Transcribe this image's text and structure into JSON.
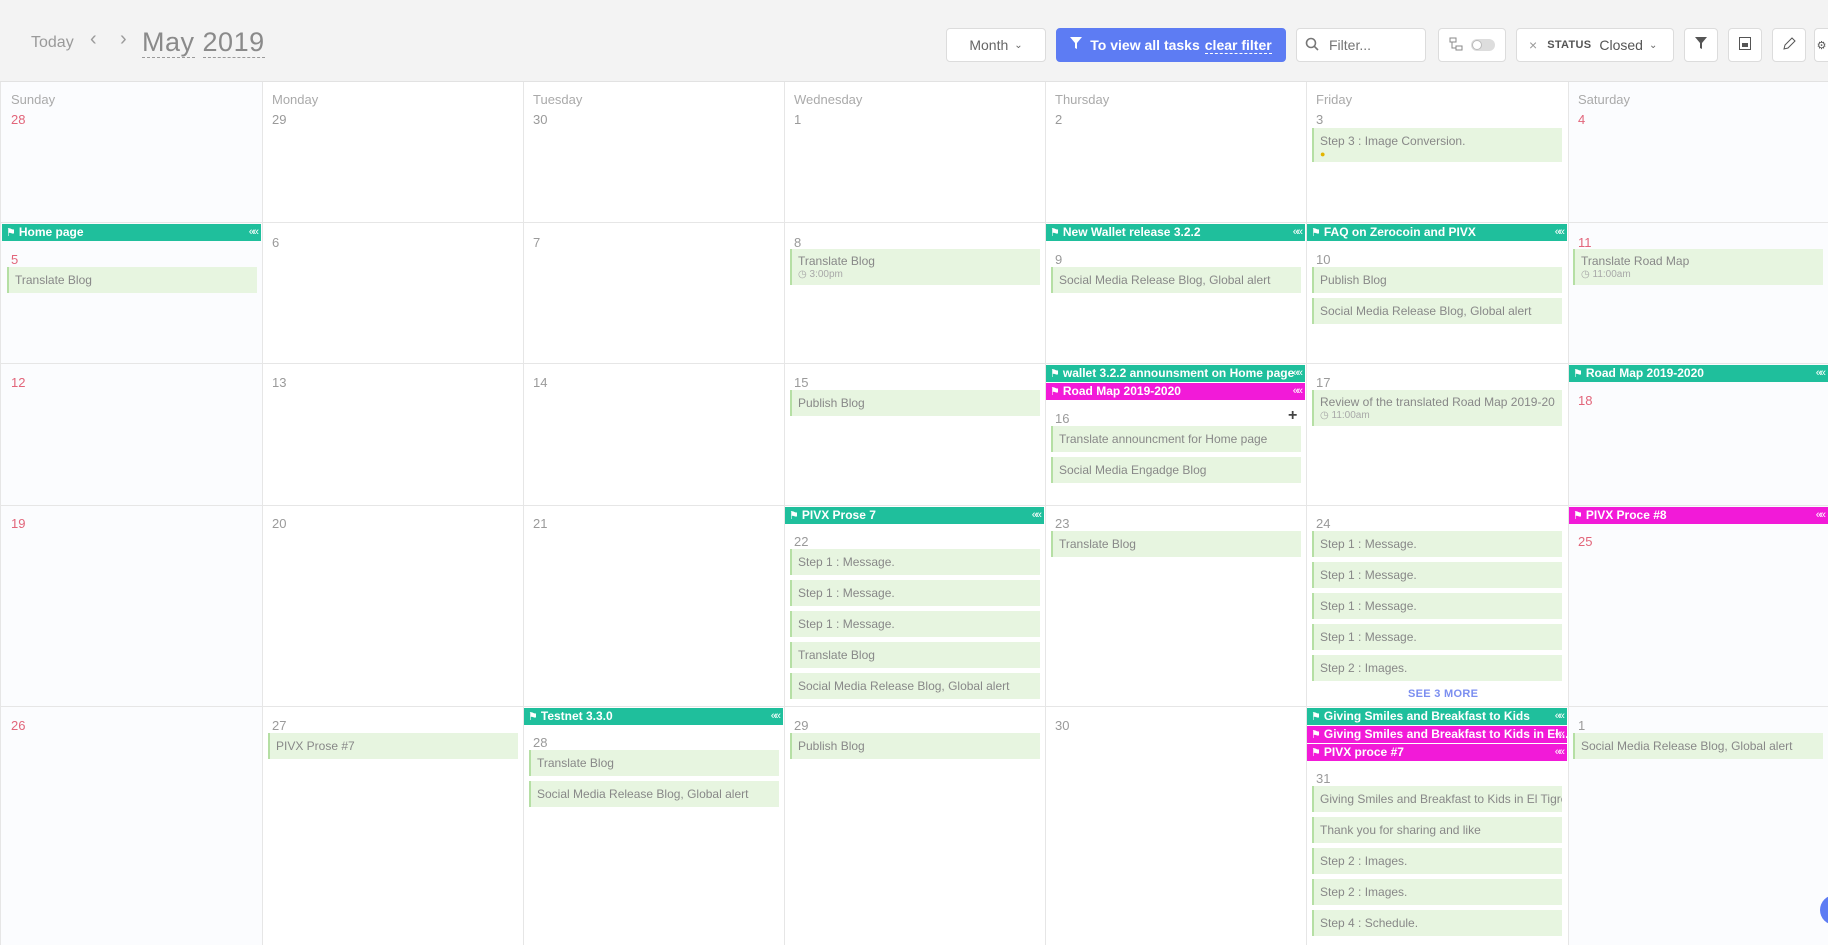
{
  "toolbar": {
    "today_label": "Today",
    "month_label": "May",
    "year_label": "2019",
    "view_select": "Month",
    "filter_banner_text": "To view all tasks",
    "filter_banner_link": "clear filter",
    "filter_placeholder": "Filter...",
    "status_label": "STATUS",
    "status_value": "Closed"
  },
  "weekdays": [
    "Sunday",
    "Monday",
    "Tuesday",
    "Wednesday",
    "Thursday",
    "Friday",
    "Saturday"
  ],
  "weeks": [
    [
      "28",
      "29",
      "30",
      "1",
      "2",
      "3",
      "4"
    ],
    [
      "5",
      "6",
      "7",
      "8",
      "9",
      "10",
      "11"
    ],
    [
      "12",
      "13",
      "14",
      "15",
      "16",
      "17",
      "18"
    ],
    [
      "19",
      "20",
      "21",
      "22",
      "23",
      "24",
      "25"
    ],
    [
      "26",
      "27",
      "28",
      "29",
      "30",
      "31",
      "1"
    ]
  ],
  "bars": {
    "home_page": "Home page",
    "new_wallet": "New Wallet release 3.2.2",
    "faq": "FAQ on Zerocoin and PIVX",
    "wallet_announce": "wallet 3.2.2 announsment on Home page",
    "roadmap_thu": "Road Map 2019-2020",
    "roadmap_sat": "Road Map 2019-2020",
    "pivx_prose7": "PIVX Prose 7",
    "pivx_proce8": "PIVX Proce #8",
    "testnet": "Testnet 3.3.0",
    "giving_smiles": "Giving Smiles and Breakfast to Kids",
    "giving_smiles_el": "Giving Smiles and Breakfast to Kids in El...",
    "pivx_proce7": "PIVX proce #7"
  },
  "tasks": {
    "step3_image": "Step 3 : Image Conversion.",
    "translate_blog_5": "Translate Blog",
    "translate_blog_8": "Translate Blog",
    "time_3pm": "3:00pm",
    "social_9": "Social Media Release Blog, Global alert",
    "publish_10": "Publish Blog",
    "social_10": "Social Media Release Blog, Global alert",
    "translate_roadmap": "Translate Road Map",
    "time_11am_a": "11:00am",
    "publish_15": "Publish Blog",
    "translate_announce": "Translate announcment for Home page",
    "social_engadge": "Social Media Engadge Blog",
    "review_roadmap": "Review of the translated Road Map 2019-20",
    "time_11am_b": "11:00am",
    "step1_a": "Step 1 : Message.",
    "step1_b": "Step 1 : Message.",
    "step1_c": "Step 1 : Message.",
    "translate_blog_22": "Translate Blog",
    "social_22": "Social Media Release Blog, Global alert",
    "translate_blog_23": "Translate Blog",
    "step1_d": "Step 1 : Message.",
    "step1_e": "Step 1 : Message.",
    "step1_f": "Step 1 : Message.",
    "step1_g": "Step 1 : Message.",
    "step2_a": "Step 2 : Images.",
    "see_more": "SEE 3 MORE",
    "pivx_prose_27": "PIVX Prose #7",
    "translate_blog_28": "Translate Blog",
    "social_28": "Social Media Release Blog, Global alert",
    "publish_29": "Publish Blog",
    "giving_31": "Giving Smiles and Breakfast to Kids in El Tigre",
    "thank_you": "Thank you for sharing and like",
    "step2_b": "Step 2 : Images.",
    "step2_c": "Step 2 : Images.",
    "step4": "Step 4 : Schedule.",
    "social_jun1": "Social Media Release Blog, Global alert"
  },
  "colors": {
    "accent_blue": "#5d7cf3",
    "bar_teal": "#1fbf9c",
    "bar_pink": "#f21ad8",
    "task_bg": "#e7f5e0",
    "weekend_red": "#e2657a"
  }
}
